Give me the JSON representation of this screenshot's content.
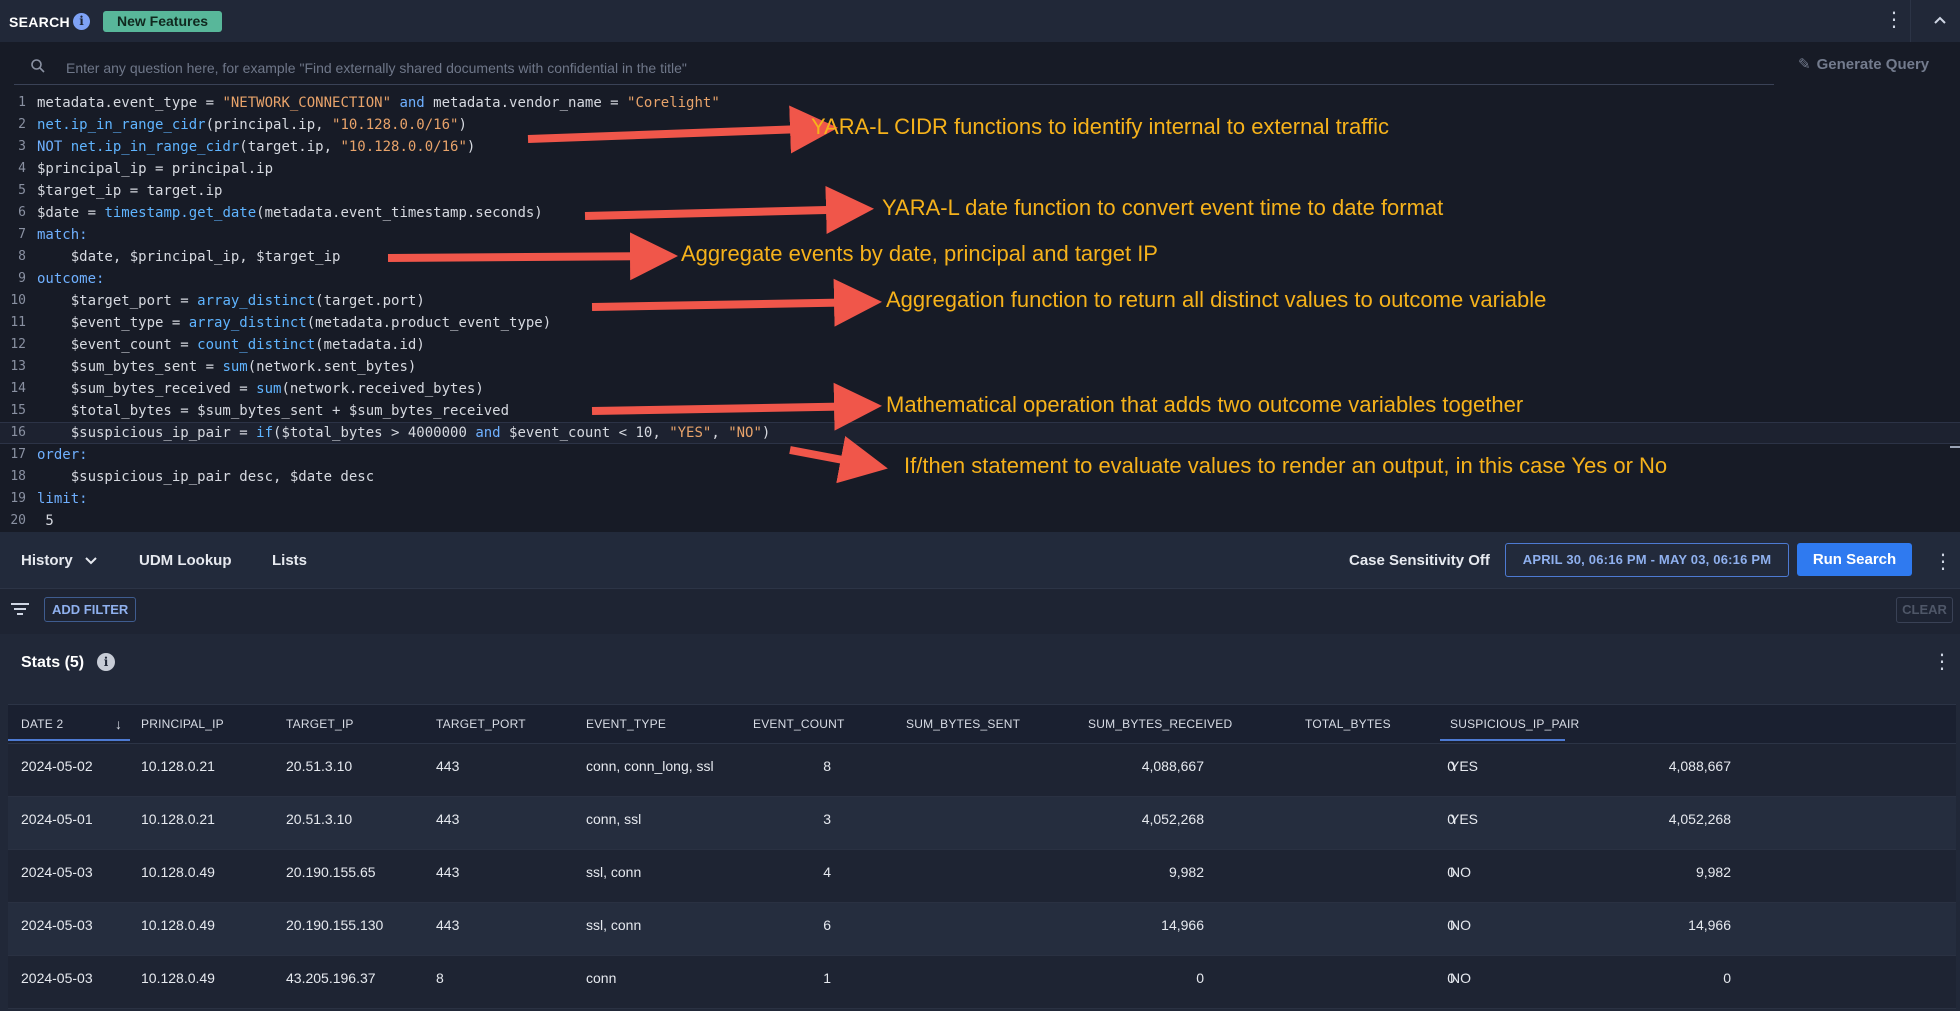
{
  "header": {
    "title": "SEARCH",
    "info_glyph": "i",
    "badge": "New Features",
    "kebab": "⋮"
  },
  "search": {
    "placeholder": "Enter any question here, for example \"Find externally shared documents with confidential in the title\"",
    "generate_label": "Generate Query"
  },
  "code_lines": [
    {
      "n": "1"
    },
    {
      "n": "2"
    },
    {
      "n": "3"
    },
    {
      "n": "4"
    },
    {
      "n": "5"
    },
    {
      "n": "6"
    },
    {
      "n": "7"
    },
    {
      "n": "8"
    },
    {
      "n": "9"
    },
    {
      "n": "10"
    },
    {
      "n": "11"
    },
    {
      "n": "12"
    },
    {
      "n": "13"
    },
    {
      "n": "14"
    },
    {
      "n": "15"
    },
    {
      "n": "16"
    },
    {
      "n": "17"
    },
    {
      "n": "18"
    },
    {
      "n": "19"
    },
    {
      "n": "20"
    }
  ],
  "code": {
    "l1": [
      [
        "metadata.event_type = ",
        ""
      ],
      [
        "\"NETWORK_CONNECTION\"",
        "str"
      ],
      [
        " and ",
        "kw"
      ],
      [
        "metadata.vendor_name = ",
        ""
      ],
      [
        "\"Corelight\"",
        "str"
      ]
    ],
    "l2": [
      [
        "net.ip_in_range_cidr",
        "fn"
      ],
      [
        "(principal.ip, ",
        ""
      ],
      [
        "\"10.128.0.0/16\"",
        "str"
      ],
      [
        ")",
        ""
      ]
    ],
    "l3": [
      [
        "NOT ",
        "kw"
      ],
      [
        "net.ip_in_range_cidr",
        "fn"
      ],
      [
        "(target.ip, ",
        ""
      ],
      [
        "\"10.128.0.0/16\"",
        "str"
      ],
      [
        ")",
        ""
      ]
    ],
    "l4": [
      [
        "$principal_ip = principal.ip",
        ""
      ]
    ],
    "l5": [
      [
        "$target_ip = target.ip",
        ""
      ]
    ],
    "l6": [
      [
        "$date = ",
        ""
      ],
      [
        "timestamp.get_date",
        "fn"
      ],
      [
        "(metadata.event_timestamp.seconds)",
        ""
      ]
    ],
    "l7": [
      [
        "match:",
        "kw"
      ]
    ],
    "l8": [
      [
        "    $date, $principal_ip, $target_ip",
        ""
      ]
    ],
    "l9": [
      [
        "outcome:",
        "kw"
      ]
    ],
    "l10": [
      [
        "    $target_port = ",
        ""
      ],
      [
        "array_distinct",
        "fn"
      ],
      [
        "(target.port)",
        ""
      ]
    ],
    "l11": [
      [
        "    $event_type = ",
        ""
      ],
      [
        "array_distinct",
        "fn"
      ],
      [
        "(metadata.product_event_type)",
        ""
      ]
    ],
    "l12": [
      [
        "    $event_count = ",
        ""
      ],
      [
        "count_distinct",
        "fn"
      ],
      [
        "(metadata.id)",
        ""
      ]
    ],
    "l13": [
      [
        "    $sum_bytes_sent = ",
        ""
      ],
      [
        "sum",
        "fn"
      ],
      [
        "(network.sent_bytes)",
        ""
      ]
    ],
    "l14": [
      [
        "    $sum_bytes_received = ",
        ""
      ],
      [
        "sum",
        "fn"
      ],
      [
        "(network.received_bytes)",
        ""
      ]
    ],
    "l15": [
      [
        "    $total_bytes = $sum_bytes_sent + $sum_bytes_received",
        ""
      ]
    ],
    "l16": [
      [
        "    $suspicious_ip_pair = ",
        ""
      ],
      [
        "if",
        "fn"
      ],
      [
        "($total_bytes > 4000000 ",
        ""
      ],
      [
        "and",
        "kw"
      ],
      [
        " $event_count < 10, ",
        ""
      ],
      [
        "\"YES\"",
        "str"
      ],
      [
        ", ",
        ""
      ],
      [
        "\"NO\"",
        "str"
      ],
      [
        ")",
        ""
      ]
    ],
    "l17": [
      [
        "order:",
        "kw"
      ]
    ],
    "l18": [
      [
        "    $suspicious_ip_pair desc, $date desc",
        ""
      ]
    ],
    "l19": [
      [
        "limit:",
        "kw"
      ]
    ],
    "l20": [
      [
        " 5",
        ""
      ]
    ]
  },
  "annotations": {
    "a1": "YARA-L CIDR functions to identify internal to external traffic",
    "a2": "YARA-L date function to convert event time to date format",
    "a3": "Aggregate events by date, principal and target IP",
    "a4": "Aggregation function to return all distinct values  to outcome variable",
    "a5": "Mathematical operation that adds two outcome variables together",
    "a6": "If/then statement to evaluate values to render an output, in this case Yes or No",
    "arrow_color": "#f0564a",
    "text_color": "#f6b21b"
  },
  "toolbar": {
    "history": "History",
    "udm": "UDM Lookup",
    "lists": "Lists",
    "case": "Case Sensitivity Off",
    "daterange": "APRIL 30, 06:16 PM - MAY 03, 06:16 PM",
    "run": "Run Search",
    "kebab": "⋮"
  },
  "filter": {
    "add": "ADD FILTER",
    "clear": "CLEAR"
  },
  "stats": {
    "title": "Stats (5)",
    "info_glyph": "i",
    "kebab": "⋮",
    "columns": [
      "DATE 2",
      "PRINCIPAL_IP",
      "TARGET_IP",
      "TARGET_PORT",
      "EVENT_TYPE",
      "EVENT_COUNT",
      "SUM_BYTES_SENT",
      "SUM_BYTES_RECEIVED",
      "TOTAL_BYTES",
      "SUSPICIOUS_IP_PAIR 1"
    ],
    "sort_arrow": "↓",
    "rows": [
      [
        "2024-05-02",
        "10.128.0.21",
        "20.51.3.10",
        "443",
        "conn, conn_long, ssl",
        "8",
        "4,088,667",
        "0",
        "4,088,667",
        "YES"
      ],
      [
        "2024-05-01",
        "10.128.0.21",
        "20.51.3.10",
        "443",
        "conn, ssl",
        "3",
        "4,052,268",
        "0",
        "4,052,268",
        "YES"
      ],
      [
        "2024-05-03",
        "10.128.0.49",
        "20.190.155.65",
        "443",
        "ssl, conn",
        "4",
        "9,982",
        "0",
        "9,982",
        "NO"
      ],
      [
        "2024-05-03",
        "10.128.0.49",
        "20.190.155.130",
        "443",
        "ssl, conn",
        "6",
        "14,966",
        "0",
        "14,966",
        "NO"
      ],
      [
        "2024-05-03",
        "10.128.0.49",
        "43.205.196.37",
        "8",
        "conn",
        "1",
        "0",
        "0",
        "0",
        "NO"
      ]
    ]
  }
}
